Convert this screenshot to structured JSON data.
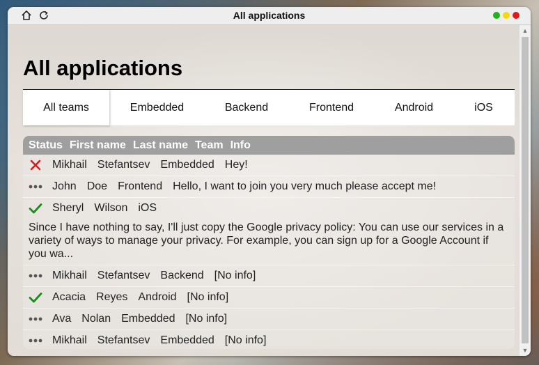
{
  "window": {
    "title": "All applications",
    "icons": [
      "home-icon",
      "refresh-icon"
    ],
    "traffic_lights": [
      "#1db41d",
      "#f5d90a",
      "#e11b1b"
    ]
  },
  "main": {
    "title": "All applications"
  },
  "tabs": [
    {
      "label": "All teams",
      "active": true
    },
    {
      "label": "Embedded",
      "active": false
    },
    {
      "label": "Backend",
      "active": false
    },
    {
      "label": "Frontend",
      "active": false
    },
    {
      "label": "Android",
      "active": false
    },
    {
      "label": "iOS",
      "active": false
    }
  ],
  "table": {
    "headers": [
      "Status",
      "First name",
      "Last name",
      "Team",
      "Info"
    ],
    "rows": [
      {
        "status": "rejected-x-icon",
        "first": "Mikhail",
        "last": "Stefantsev",
        "team": "Embedded",
        "info": "Hey!"
      },
      {
        "status": "pending-dots-icon",
        "first": "John",
        "last": "Doe",
        "team": "Frontend",
        "info": "Hello, I want to join you very much please accept me!"
      },
      {
        "status": "accepted-check-icon",
        "first": "Sheryl",
        "last": "Wilson",
        "team": "iOS",
        "info": "Since I have nothing to say, I'll just copy the Google privacy policy: You can use our services in a variety of ways to manage your privacy. For example, you can sign up for a Google Account if you wa..."
      },
      {
        "status": "pending-dots-icon",
        "first": "Mikhail",
        "last": "Stefantsev",
        "team": "Backend",
        "info": "[No info]"
      },
      {
        "status": "accepted-check-icon",
        "first": "Acacia",
        "last": "Reyes",
        "team": "Android",
        "info": "[No info]"
      },
      {
        "status": "pending-dots-icon",
        "first": "Ava",
        "last": "Nolan",
        "team": "Embedded",
        "info": "[No info]"
      },
      {
        "status": "pending-dots-icon",
        "first": "Mikhail",
        "last": "Stefantsev",
        "team": "Embedded",
        "info": "[No info]"
      }
    ]
  },
  "colors": {
    "reject": "#d61d1d",
    "accept": "#1a8c1a",
    "pending": "#555555",
    "header_bg": "#9f9f9f"
  }
}
